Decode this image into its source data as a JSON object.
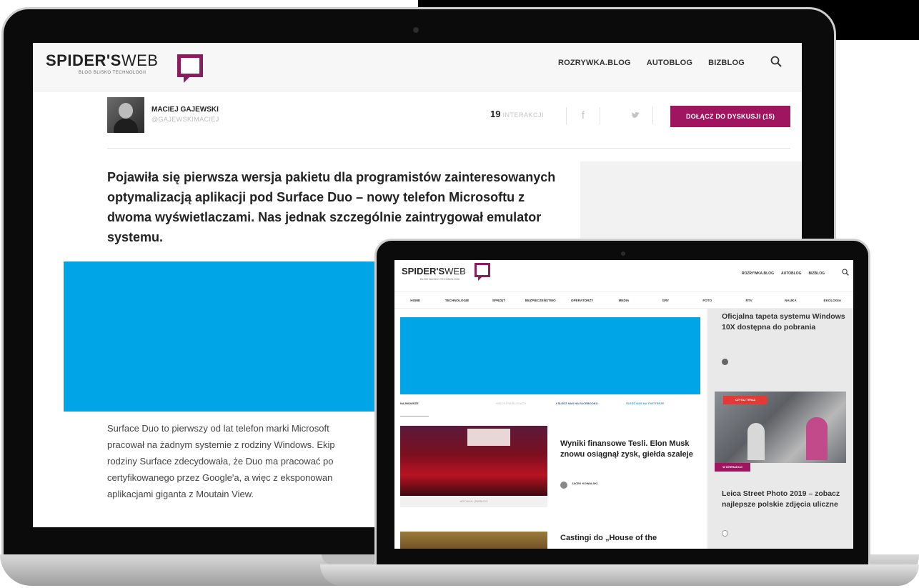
{
  "laptop": {
    "logo": {
      "bold": "SPIDER'S",
      "light": "WEB",
      "tagline": "BLOG BLISKO TECHNOLOGII"
    },
    "nav": [
      "ROZRYWKA.BLOG",
      "AUTOBLOG",
      "BIZBLOG"
    ],
    "author": {
      "name": "MACIEJ GAJEWSKI",
      "handle": "@GAJEWSKIMACIEJ"
    },
    "interactions": {
      "count": "19",
      "label": "INTERAKCJI"
    },
    "share": {
      "facebook": "f",
      "twitter": "🐦"
    },
    "join_button": "DOŁĄCZ DO DYSKUSJI (15)",
    "lead": "Pojawiła się pierwsza wersja pakietu dla programistów zainteresowanych optymalizacją aplikacji pod Surface Duo – nowy telefon Microsoftu z dwoma wyświetlaczami. Nas jednak szczególnie zaintrygował emulator systemu.",
    "body_lines": [
      "Surface Duo to pierwszy od lat telefon marki Microsoft",
      "pracował na żadnym systemie z rodziny Windows. Ekip",
      "rodziny Surface zdecydowała, że Duo ma pracować po",
      "certyfikowanego przez Google'a, a więc z eksponowan",
      "aplikacjami giganta z Moutain View."
    ],
    "accent_color": "#a0155f",
    "ad_color": "#00a5e8"
  },
  "tablet": {
    "logo": {
      "bold": "SPIDER'S",
      "light": "WEB",
      "tagline": "BLOG BLISKO TECHNOLOGII"
    },
    "nav": [
      "ROZRYWKA.BLOG",
      "AUTOBLOG",
      "BIZBLOG"
    ],
    "categories": [
      "HOME",
      "TECHNOLOGIE",
      "SPRZĘT",
      "BEZPIECZEŃSTWO",
      "OPERATORZY",
      "MEDIA",
      "GRY",
      "FOTO",
      "RTV",
      "NAUKA",
      "EKOLOGIA"
    ],
    "strip": {
      "newest": "NAJNOWSZE",
      "middle": "WIĘCEJ NA BLOGACH",
      "facebook": "f  ŚLEDŹ NAS NA FACEBOOKU",
      "twitter": "ŚLEDŹ NAS NA TWITTERZE"
    },
    "article1": {
      "title": "Wyniki finansowe Tesli. Elon Musk znowu osiągnął zysk, giełda szaleje",
      "caption": "ARTYKUŁ   |   BIZBLOG",
      "author": "JACEK KOWALSKI"
    },
    "article2": {
      "title": "Castingi do „House of the"
    },
    "side1": {
      "title": "Oficjalna tapeta systemu Windows 10X dostępna do pobrania"
    },
    "side2": {
      "badge_top": "CZYTAJ TERAZ",
      "badge_bottom": "W INTERAKCJI",
      "title": "Leica Street Photo 2019 – zobacz najlepsze polskie zdjęcia uliczne"
    }
  }
}
